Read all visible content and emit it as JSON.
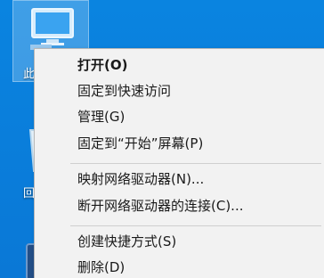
{
  "desktop": {
    "icons": [
      {
        "label": "此",
        "name": "this-pc"
      },
      {
        "label": "回",
        "name": "recycle-bin"
      }
    ]
  },
  "context_menu": {
    "items": [
      {
        "label": "打开(O)",
        "bold": true
      },
      {
        "label": "固定到快速访问"
      },
      {
        "label": "管理(G)"
      },
      {
        "label": "固定到“开始”屏幕(P)"
      },
      {
        "label": "映射网络驱动器(N)..."
      },
      {
        "label": "断开网络驱动器的连接(C)..."
      },
      {
        "label": "创建快捷方式(S)"
      },
      {
        "label": "删除(D)"
      }
    ]
  }
}
